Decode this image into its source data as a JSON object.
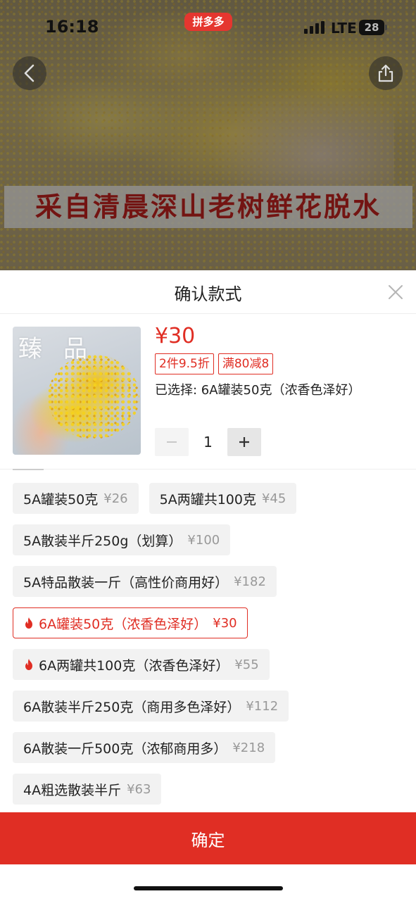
{
  "status_bar": {
    "time": "16:18",
    "app_badge": "拼多多",
    "network": "LTE",
    "battery": "28"
  },
  "banner": {
    "caption": "采自清晨深山老树鲜花脱水"
  },
  "sheet": {
    "title": "确认款式"
  },
  "product": {
    "thumbnail_text": "臻品",
    "price": "¥30",
    "promo_tags": [
      "2件9.5折",
      "满80减8"
    ],
    "selected_label": "已选择: 6A罐装50克（浓香色泽好）",
    "quantity": "1"
  },
  "options": [
    {
      "label": "5A罐装50克",
      "price": "¥26",
      "hot": false,
      "selected": false
    },
    {
      "label": "5A两罐共100克",
      "price": "¥45",
      "hot": false,
      "selected": false
    },
    {
      "label": "5A散装半斤250g（划算）",
      "price": "¥100",
      "hot": false,
      "selected": false
    },
    {
      "label": "5A特品散装一斤（高性价商用好）",
      "price": "¥182",
      "hot": false,
      "selected": false
    },
    {
      "label": "6A罐装50克（浓香色泽好）",
      "price": "¥30",
      "hot": true,
      "selected": true
    },
    {
      "label": "6A两罐共100克（浓香色泽好）",
      "price": "¥55",
      "hot": true,
      "selected": false
    },
    {
      "label": "6A散装半斤250克（商用多色泽好）",
      "price": "¥112",
      "hot": false,
      "selected": false
    },
    {
      "label": "6A散装一斤500克（浓郁商用多）",
      "price": "¥218",
      "hot": false,
      "selected": false
    },
    {
      "label": "4A粗选散装半斤",
      "price": "¥63",
      "hot": false,
      "selected": false
    }
  ],
  "confirm_button": {
    "label": "确定"
  },
  "colors": {
    "accent": "#e02e24",
    "option_bg": "#f2f2f2"
  }
}
